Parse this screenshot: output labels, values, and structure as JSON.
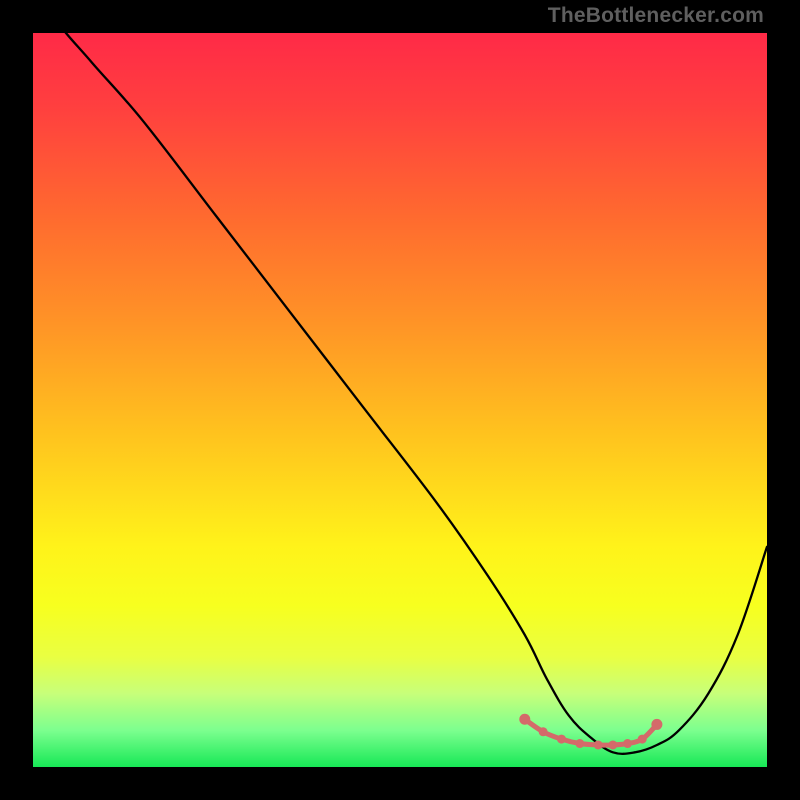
{
  "watermark": "TheBottlenecker.com",
  "chart_data": {
    "type": "line",
    "title": "",
    "xlabel": "",
    "ylabel": "",
    "xlim": [
      0,
      100
    ],
    "ylim": [
      0,
      100
    ],
    "gradient_stops": [
      {
        "offset": 0.0,
        "color": "#ff2a47"
      },
      {
        "offset": 0.1,
        "color": "#ff3f3f"
      },
      {
        "offset": 0.25,
        "color": "#ff6a2f"
      },
      {
        "offset": 0.4,
        "color": "#ff9526"
      },
      {
        "offset": 0.55,
        "color": "#ffc41e"
      },
      {
        "offset": 0.7,
        "color": "#fff31a"
      },
      {
        "offset": 0.78,
        "color": "#f7ff1f"
      },
      {
        "offset": 0.85,
        "color": "#e9ff42"
      },
      {
        "offset": 0.9,
        "color": "#c7ff7a"
      },
      {
        "offset": 0.95,
        "color": "#7cff8f"
      },
      {
        "offset": 1.0,
        "color": "#17e856"
      }
    ],
    "series": [
      {
        "name": "bottleneck-curve",
        "x": [
          0,
          3,
          8,
          15,
          25,
          35,
          45,
          55,
          62,
          67,
          70,
          73,
          76,
          79,
          82,
          85,
          88,
          92,
          96,
          100
        ],
        "y": [
          108,
          102,
          96,
          88,
          75,
          62,
          49,
          36,
          26,
          18,
          12,
          7,
          4,
          2,
          2,
          3,
          5,
          10,
          18,
          30
        ]
      }
    ],
    "highlight": {
      "name": "optimal-range",
      "color": "#d46a6a",
      "points_x": [
        67,
        69.5,
        72,
        74.5,
        77,
        79,
        81,
        83,
        85
      ],
      "points_y": [
        6.5,
        4.8,
        3.8,
        3.2,
        3.0,
        3.0,
        3.2,
        3.8,
        5.8
      ]
    }
  }
}
